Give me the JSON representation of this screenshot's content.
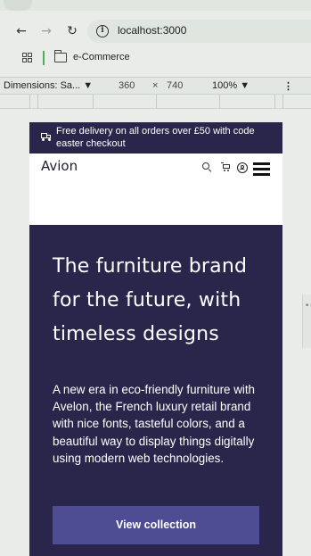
{
  "browser": {
    "url": "localhost:3000",
    "bookmark_folder_label": "e-Commerce",
    "icons": {
      "back": "arrow-left-icon",
      "forward": "arrow-right-icon",
      "reload": "reload-icon",
      "site_info": "info-icon",
      "apps": "apps-grid-icon",
      "folder": "folder-icon"
    }
  },
  "devtools": {
    "dimensions_label": "Dimensions: Sa... ▼",
    "width": "360",
    "times": "×",
    "height": "740",
    "zoom": "100% ▼",
    "more": "⋮"
  },
  "site": {
    "promo_text": "Free delivery on all orders over £50 with code easter checkout",
    "logo": "Avion",
    "hero": {
      "title": "The furniture brand for the future, with timeless designs",
      "description": "A new era in eco-friendly furniture with Avelon, the French luxury retail brand with nice fonts, tasteful colors, and a beautiful way to display things digitally using modern web technologies.",
      "cta_label": "View collection"
    },
    "colors": {
      "brand_dark": "#2a254b",
      "button": "#4e4d93",
      "text_light": "#ffffff"
    }
  }
}
